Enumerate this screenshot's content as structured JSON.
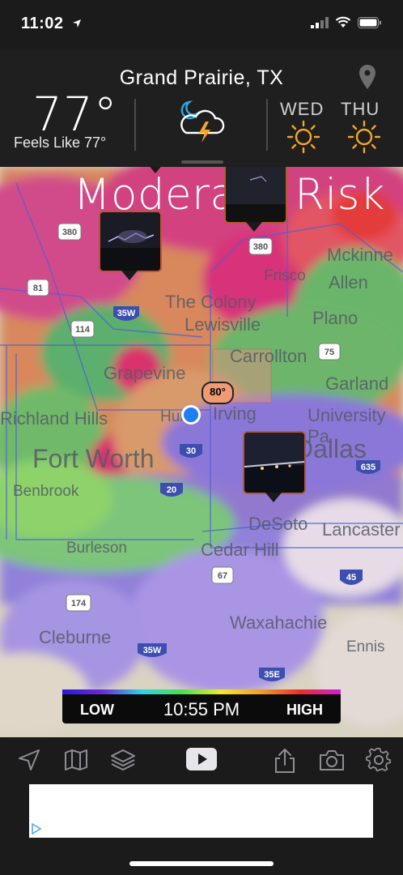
{
  "status_bar": {
    "time": "11:02",
    "icons": [
      "location-arrow-icon",
      "cellular-signal-icon",
      "wifi-icon",
      "battery-icon"
    ]
  },
  "header": {
    "location": "Grand Prairie, TX",
    "temperature": "77°",
    "feels_like": "Feels Like 77°",
    "condition_icon": "thunderstorm-night-icon",
    "forecast": [
      {
        "day": "WED",
        "icon": "sun-icon"
      },
      {
        "day": "THU",
        "icon": "sun-icon"
      }
    ]
  },
  "map": {
    "risk_label": "Moderate Risk",
    "temp_marker": "80°",
    "cities": [
      "Mckinne",
      "Allen",
      "Frisco",
      "The Colony",
      "Lewisville",
      "Plano",
      "Carrollton",
      "Grapevine",
      "Irving",
      "Garland",
      "Richland Hills",
      "Hurst",
      "University Pa",
      "Fort Worth",
      "Dallas",
      "Benbrook",
      "DeSoto",
      "Lancaster",
      "Burleson",
      "Cedar Hill",
      "Cleburne",
      "Waxahachie",
      "Ennis"
    ],
    "highway_shields": [
      "380",
      "380",
      "81",
      "114",
      "35W",
      "75",
      "30",
      "20",
      "635",
      "67",
      "174",
      "45",
      "35W",
      "35E"
    ],
    "photo_markers": [
      "lightning-photo",
      "storm-photo",
      "city-night-photo"
    ]
  },
  "legend": {
    "low": "LOW",
    "high": "HIGH",
    "time": "10:55 PM"
  },
  "toolbar": {
    "icons": [
      "navigation-arrow-icon",
      "map-icon",
      "layers-icon",
      "play-icon",
      "share-icon",
      "camera-icon",
      "settings-gear-icon"
    ]
  },
  "colors": {
    "marker_orange": "#f09a74",
    "location_blue": "#1e7ff5",
    "thumb_border": "#b9572e"
  }
}
